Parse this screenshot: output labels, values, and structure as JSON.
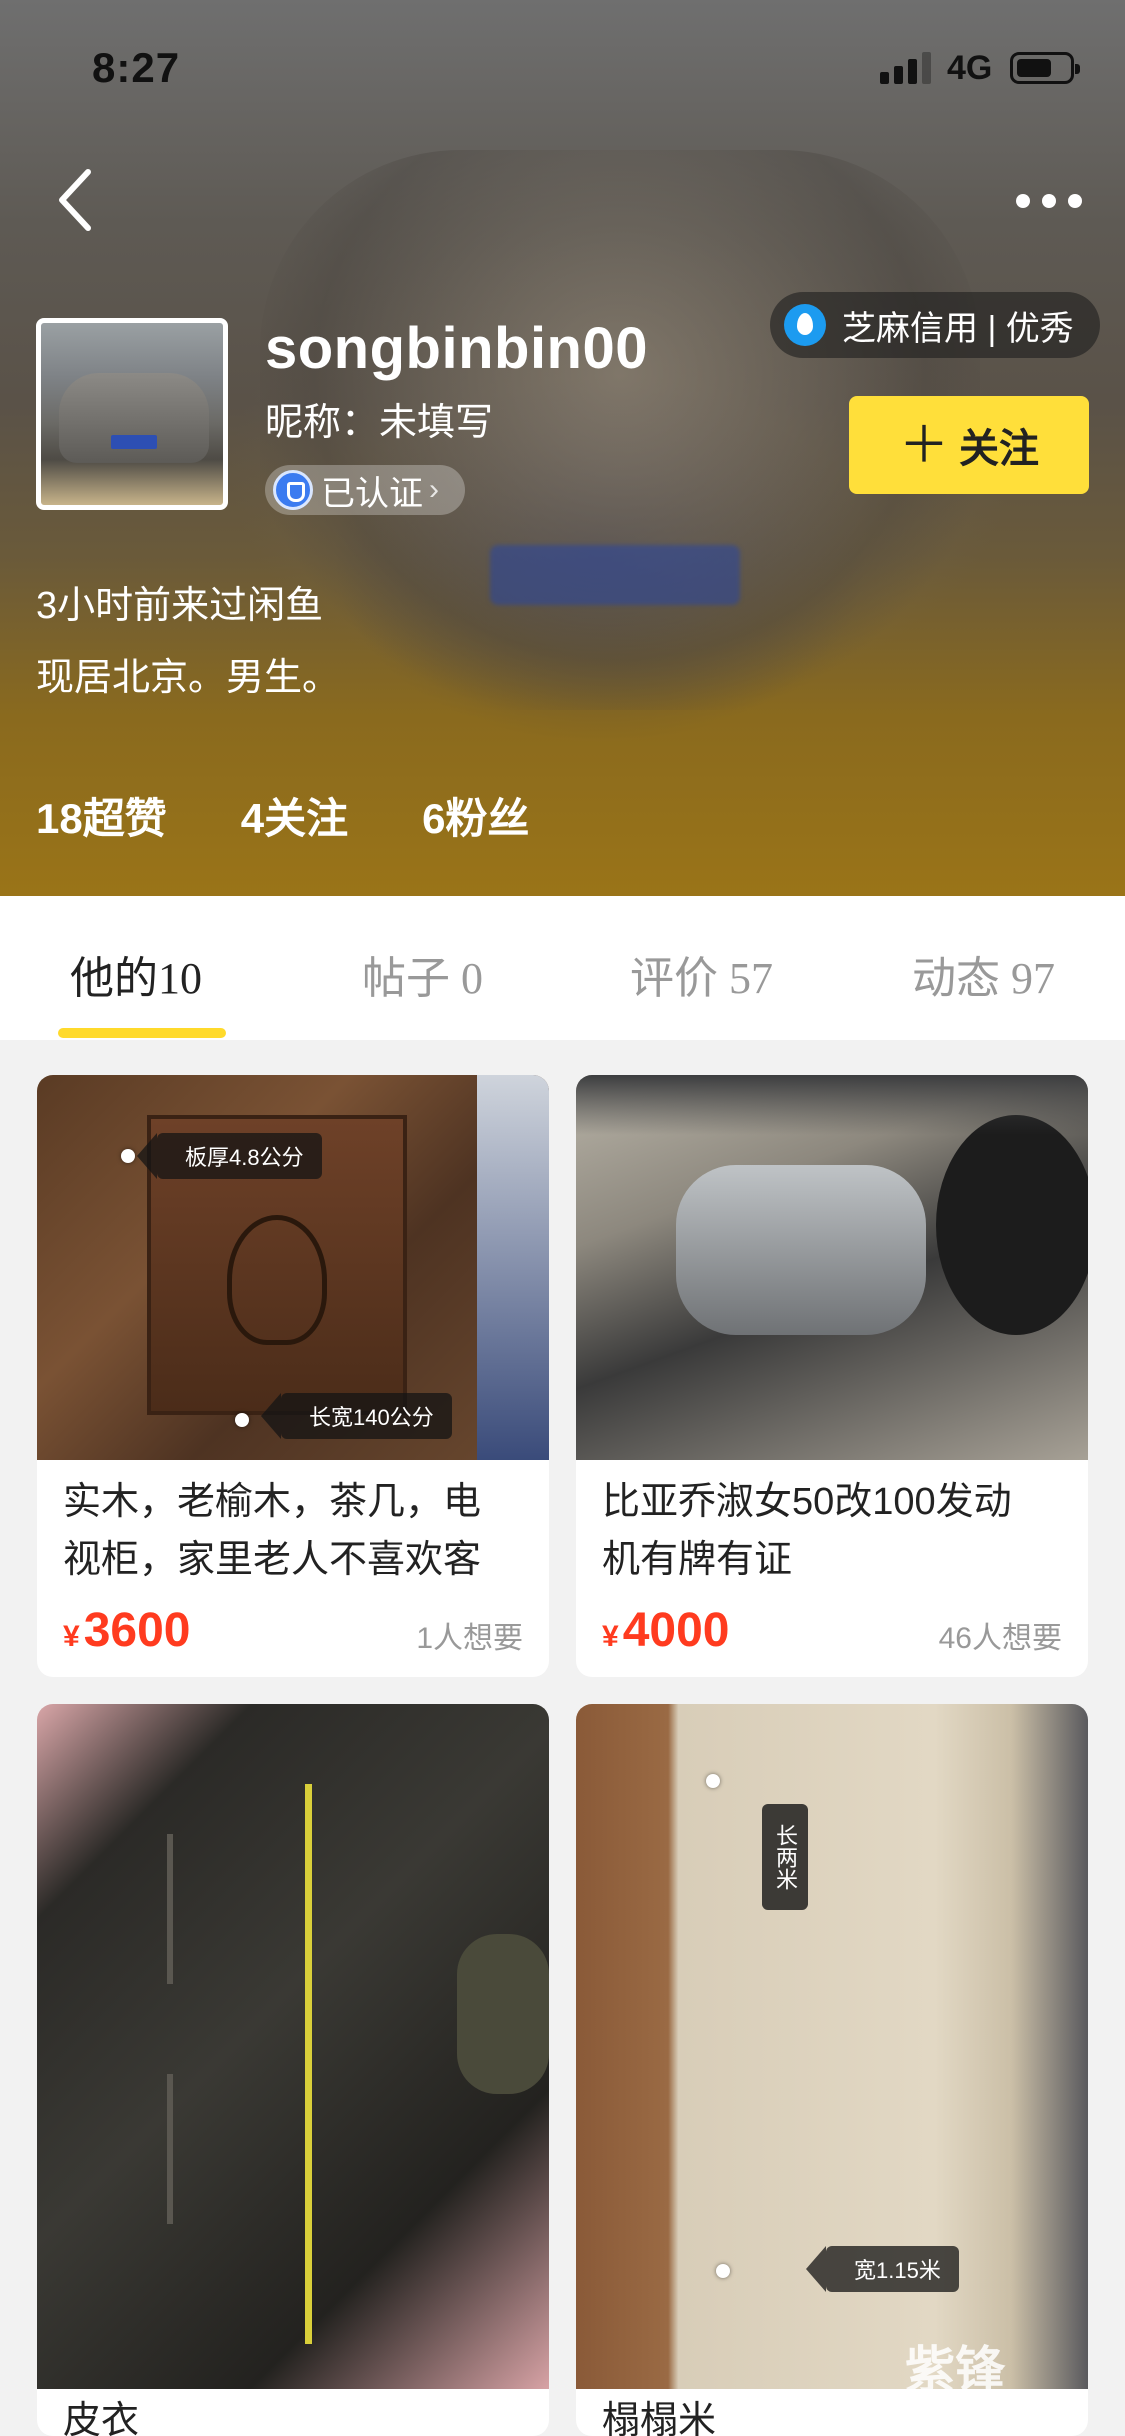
{
  "status_bar": {
    "time": "8:27",
    "network": "4G"
  },
  "profile": {
    "username": "songbinbin00",
    "nickname": "昵称：未填写",
    "verified_label": "已认证",
    "credit_label": "芝麻信用 | 优秀",
    "follow_label": "关注",
    "last_seen": "3小时前来过闲鱼",
    "location": "现居北京。男生。",
    "stats": {
      "likes": "18超赞",
      "following": "4关注",
      "fans": "6粉丝"
    }
  },
  "tabs": [
    {
      "label": "他的",
      "count": "10"
    },
    {
      "label": "帖子 ",
      "count": "0"
    },
    {
      "label": "评价 ",
      "count": "57"
    },
    {
      "label": "动态 ",
      "count": "97"
    }
  ],
  "items": [
    {
      "title_line1": "实木，老榆木，茶几，电",
      "title_line2": "视柜，家里老人不喜欢客",
      "currency": "¥",
      "price": "3600",
      "want": "1人想要",
      "tag1": "板厚4.8公分",
      "tag2": "长宽140公分"
    },
    {
      "title_line1": "比亚乔淑女50改100发动",
      "title_line2": "机有牌有证",
      "currency": "¥",
      "price": "4000",
      "want": "46人想要"
    },
    {
      "title_line1": "皮衣"
    },
    {
      "title_line1": "榻榻米",
      "tag1": "长两米",
      "tag2": "宽1.15米"
    }
  ],
  "watermark": "紫锋",
  "colors": {
    "accent_yellow": "#ffdf3a",
    "price_red": "#ff3b1f"
  }
}
